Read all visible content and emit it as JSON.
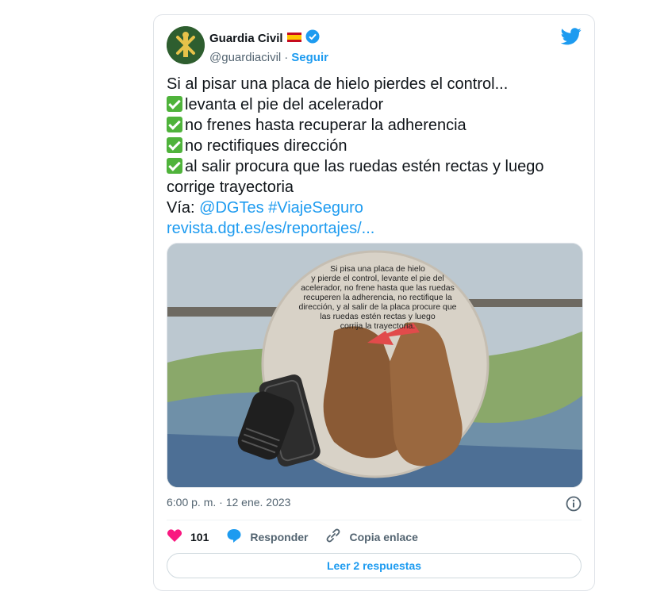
{
  "author": {
    "name": "Guardia Civil",
    "handle": "@guardiacivil",
    "separator": "·",
    "follow_label": "Seguir"
  },
  "tweet": {
    "intro": "Si al pisar una placa de hielo pierdes el control...",
    "items": [
      "levanta el pie del acelerador",
      "no frenes hasta recuperar la adherencia",
      "no rectifiques dirección",
      "al salir procura que las ruedas estén rectas y luego"
    ],
    "item_continuation": "corrige trayectoria",
    "via_prefix": "Vía:",
    "via_mention": "@DGTes",
    "via_hashtag": "#ViajeSeguro",
    "url": "revista.dgt.es/es/reportajes/..."
  },
  "media": {
    "caption_lines": [
      "Si pisa una placa de hielo",
      "y pierde el control, levante el pie del",
      "acelerador, no frene hasta que las ruedas",
      "recuperen la adherencia, no rectifique la",
      "dirección, y al salir de la placa procure que",
      "las ruedas estén rectas y luego",
      "corrija la trayectoria."
    ]
  },
  "timestamp": "6:00 p. m. · 12 ene. 2023",
  "actions": {
    "likes": "101",
    "reply_label": "Responder",
    "copy_label": "Copia enlace"
  },
  "read_replies_label": "Leer 2 respuestas",
  "icons": {
    "like": "heart-icon",
    "reply": "speech-bubble-icon",
    "copy": "link-icon",
    "info": "info-icon",
    "brand": "twitter-bird-icon",
    "verified": "verified-badge-icon",
    "flag": "spain-flag-icon"
  },
  "colors": {
    "accent": "#1d9bf0",
    "like": "#f91880",
    "check": "#4fb33b"
  }
}
